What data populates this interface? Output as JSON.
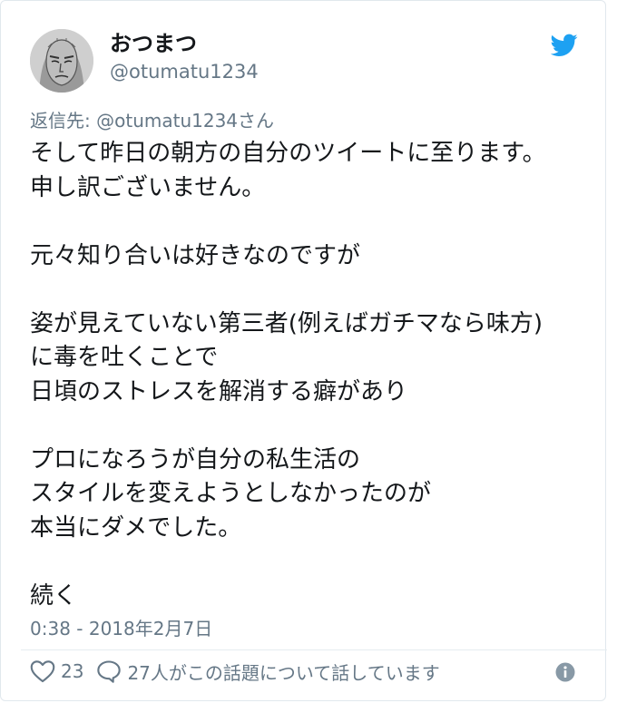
{
  "tweet": {
    "display_name": "おつまつ",
    "handle": "@otumatu1234",
    "reply_to_prefix": "返信先: ",
    "reply_to_handle": "@otumatu1234さん",
    "body_lines": [
      "そして昨日の朝方の自分のツイートに至ります。",
      "申し訳ございません。",
      "",
      "元々知り合いは好きなのですが",
      "",
      "姿が見えていない第三者(例えばガチマなら味方)",
      "に毒を吐くことで",
      "日頃のストレスを解消する癖があり",
      "",
      "プロになろうが自分の私生活の",
      "スタイルを変えようとしなかったのが",
      "本当にダメでした。",
      "",
      "続く"
    ],
    "timestamp": "0:38 - 2018年2月7日",
    "like_count": "23",
    "conversation_label": "27人がこの話題について話しています"
  },
  "icons": {
    "avatar": "avatar-image",
    "bird": "twitter-bird-icon",
    "like": "heart-icon",
    "reply": "speech-bubble-icon",
    "info": "info-icon"
  },
  "colors": {
    "brand": "#1da1f2",
    "text": "#14171a",
    "secondary": "#657786",
    "border": "#e1e8ed"
  }
}
